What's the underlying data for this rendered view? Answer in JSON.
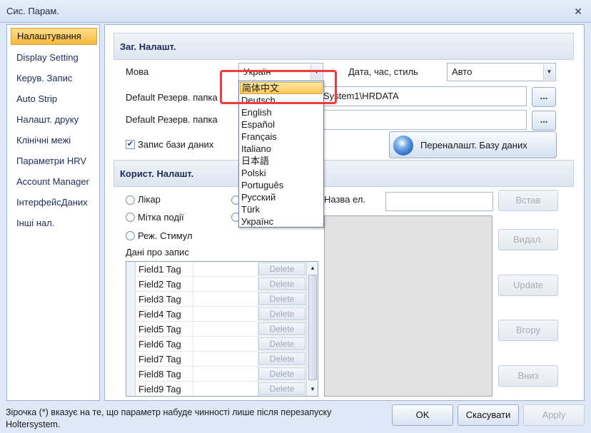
{
  "window": {
    "title": "Сис. Парам.",
    "close_glyph": "✕"
  },
  "sidebar": {
    "items": [
      {
        "label": "Налаштування"
      },
      {
        "label": "Display Setting"
      },
      {
        "label": "Керув. Запис"
      },
      {
        "label": "Auto Strip"
      },
      {
        "label": "Налашт. друку"
      },
      {
        "label": "Клінічні межі"
      },
      {
        "label": "Параметри HRV"
      },
      {
        "label": "Account Manager"
      },
      {
        "label": "ІнтерфейсДаних"
      },
      {
        "label": "Інші нал."
      }
    ],
    "active_index": 0
  },
  "general": {
    "header": "Заг. Налашт.",
    "language_label": "Мова",
    "language_value": "Україн",
    "datetime_label": "Дата, час, стиль",
    "datetime_value": "Авто",
    "backup1_label": "Default Резерв. папка",
    "backup1_value": "System1\\HRDATA",
    "backup2_label": "Default Резерв. папка",
    "backup2_value": "",
    "browse_label": "...",
    "db_record_label": "Запис бази даних",
    "db_record_checked": true,
    "reset_db_label": "Переналашт. Базу даних"
  },
  "language_dropdown": {
    "options": [
      "简体中文",
      "Deutsch",
      "English",
      "Español",
      "Français",
      "Italiano",
      "日本語",
      "Polski",
      "Português",
      "Русский",
      "Türk",
      "Українс"
    ],
    "highlighted_index": 0
  },
  "user": {
    "header": "Корист. Налашт.",
    "radio_doctor": "Лікар",
    "radio_event_mark": "Мітка події",
    "radio_stim_mode": "Реж. Стимул",
    "record_data_label": "Дані про запис",
    "element_name_label": "Назва ел.",
    "element_name_value": "",
    "fields": [
      {
        "tag": "Field1 Tag",
        "delete": "Delete"
      },
      {
        "tag": "Field2 Tag",
        "delete": "Delete"
      },
      {
        "tag": "Field3 Tag",
        "delete": "Delete"
      },
      {
        "tag": "Field4 Tag",
        "delete": "Delete"
      },
      {
        "tag": "Field5 Tag",
        "delete": "Delete"
      },
      {
        "tag": "Field6 Tag",
        "delete": "Delete"
      },
      {
        "tag": "Field7 Tag",
        "delete": "Delete"
      },
      {
        "tag": "Field8 Tag",
        "delete": "Delete"
      },
      {
        "tag": "Field9 Tag",
        "delete": "Delete"
      }
    ],
    "insert_label": "Встав",
    "remove_label": "Видал.",
    "update_label": "Update",
    "up_label": "Вгору",
    "down_label": "Вниз"
  },
  "footer": {
    "note": "Зірочка (*) вказує на те, що параметр набуде чинності лише після перезапуску Holtersystem.",
    "ok_label": "OK",
    "cancel_label": "Скасувати",
    "apply_label": "Apply"
  },
  "colors": {
    "highlight": "#f8c65a",
    "annotation_outline": "#ef3b3b",
    "panel_border": "#9fb3d1"
  }
}
